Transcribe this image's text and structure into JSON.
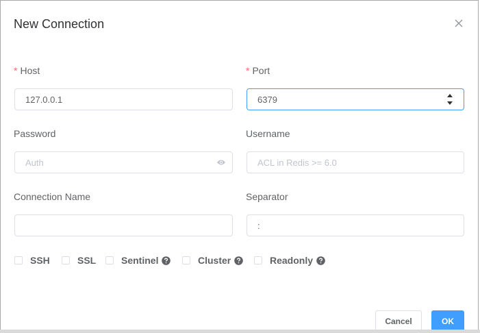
{
  "dialog": {
    "title": "New Connection"
  },
  "form": {
    "host": {
      "label": "Host",
      "value": "127.0.0.1"
    },
    "port": {
      "label": "Port",
      "value": "6379"
    },
    "password": {
      "label": "Password",
      "placeholder": "Auth",
      "value": ""
    },
    "username": {
      "label": "Username",
      "placeholder": "ACL in Redis >= 6.0",
      "value": ""
    },
    "connection_name": {
      "label": "Connection Name",
      "value": ""
    },
    "separator": {
      "label": "Separator",
      "value": ":"
    },
    "required_mark": "*"
  },
  "options": [
    {
      "label": "SSH",
      "checked": false,
      "help": false
    },
    {
      "label": "SSL",
      "checked": false,
      "help": false
    },
    {
      "label": "Sentinel",
      "checked": false,
      "help": true
    },
    {
      "label": "Cluster",
      "checked": false,
      "help": true
    },
    {
      "label": "Readonly",
      "checked": false,
      "help": true
    }
  ],
  "footer": {
    "cancel_label": "Cancel",
    "ok_label": "OK"
  },
  "icons": {
    "close": "close-icon",
    "password_toggle": "eye-icon",
    "help": "question-circle-icon",
    "spin_up": "caret-up-icon",
    "spin_down": "caret-down-icon"
  },
  "colors": {
    "primary": "#409eff",
    "required": "#f56c6c",
    "border": "#dcdfe6",
    "text": "#606266"
  }
}
